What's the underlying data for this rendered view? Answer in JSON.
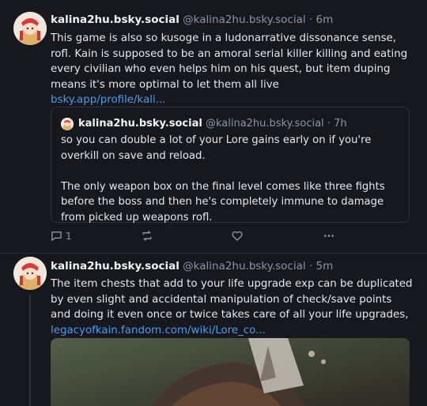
{
  "post1": {
    "display_name": "kalina2hu.bsky.social",
    "handle": "@kalina2hu.bsky.social",
    "time": "6m",
    "text": "This game is also so kusoge in a ludonarrative dissonance sense, rofl. Kain is supposed to be an amoral serial killer killing and eating every civilian who even helps him on his quest, but item duping means it's more optimal to let them all live",
    "link": "bsky.app/profile/kali...",
    "quote": {
      "display_name": "kalina2hu.bsky.social",
      "handle": "@kalina2hu.bsky.social",
      "time": "7h",
      "text1": "so you can double a lot of your Lore gains early on if you're overkill on save and reload.",
      "text2": "The only weapon box on the final level comes like three fights before the boss and then he's completely immune to damage from picked up weapons rofl."
    },
    "actions": {
      "reply_count": "1",
      "repost_count": "",
      "like_count": ""
    }
  },
  "post2": {
    "display_name": "kalina2hu.bsky.social",
    "handle": "@kalina2hu.bsky.social",
    "time": "5m",
    "text": "The item chests that add to your life upgrade exp can be duplicated by even slight and accidental manipulation of check/save points and doing it even once or twice takes care of all your life upgrades,",
    "link": "legacyofkain.fandom.com/wiki/Lore_co..."
  },
  "colors": {
    "background": "#16181d",
    "link": "#4d9bf0",
    "muted": "#8b95a3"
  }
}
